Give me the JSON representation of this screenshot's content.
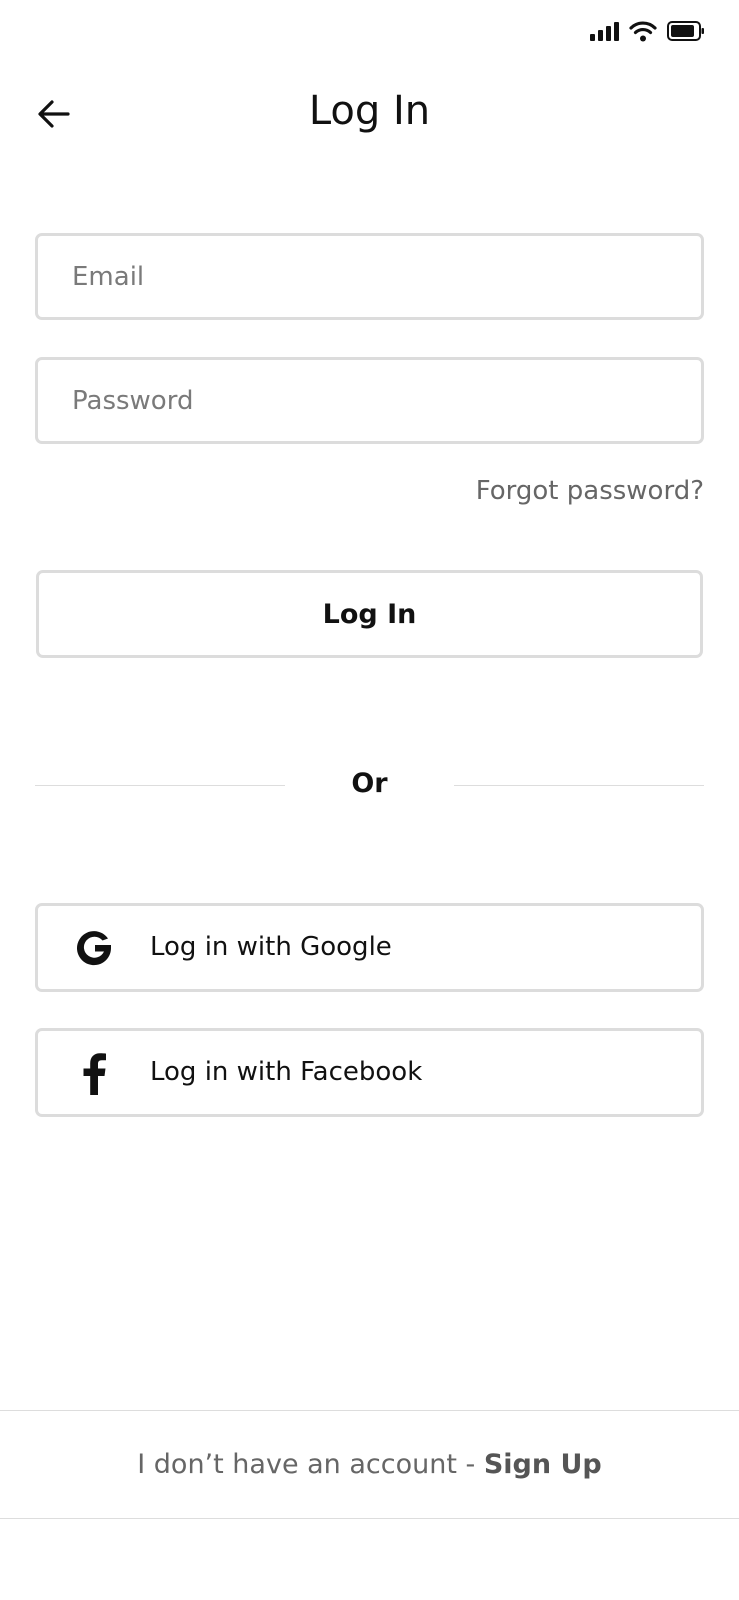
{
  "status_bar": {
    "signal_icon": "cellular-signal-icon",
    "wifi_icon": "wifi-icon",
    "battery_icon": "battery-icon"
  },
  "header": {
    "back_icon": "arrow-left-icon",
    "title": "Log In"
  },
  "form": {
    "email": {
      "placeholder": "Email",
      "value": ""
    },
    "password": {
      "placeholder": "Password",
      "value": ""
    },
    "forgot_password": "Forgot password?",
    "submit_label": "Log In"
  },
  "divider": {
    "label": "Or"
  },
  "social": {
    "google": {
      "label": "Log in with Google",
      "icon": "google-icon"
    },
    "facebook": {
      "label": "Log in with Facebook",
      "icon": "facebook-icon"
    }
  },
  "footer": {
    "prompt": "I don’t have an account - ",
    "signup_label": "Sign Up"
  },
  "colors": {
    "border": "#dcdcdc",
    "text": "#111111",
    "muted_text": "#666666",
    "divider": "#dddddd"
  }
}
